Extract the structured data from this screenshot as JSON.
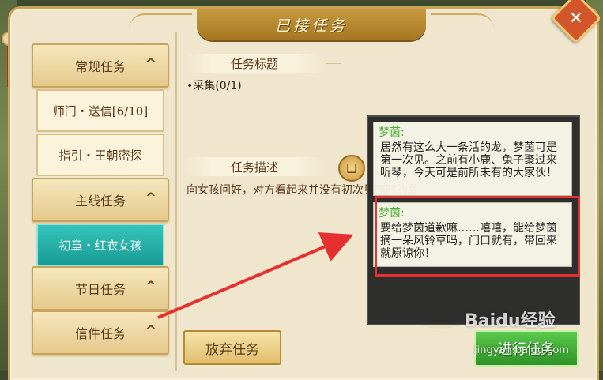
{
  "window": {
    "title": "已接任务",
    "close_label": "✕"
  },
  "categories": [
    {
      "label": "常规任务",
      "chevron": "^"
    },
    {
      "label": "主线任务",
      "chevron": "^"
    },
    {
      "label": "节日任务",
      "chevron": "^"
    },
    {
      "label": "信件任务",
      "chevron": "^"
    }
  ],
  "subtasks": [
    {
      "label": "师门・送信[6/10]"
    },
    {
      "label": "指引・王朝密探"
    },
    {
      "label": "初章・红衣女孩",
      "active": true
    }
  ],
  "task": {
    "title_head": "任务标题",
    "objective": "•采集(0/1)",
    "desc_head": "任务描述",
    "description": "向女孩问好，对方看起来并没有初次见面时的敌意"
  },
  "dialog": [
    {
      "speaker": "梦茵:",
      "text": "居然有这么大一条活的龙，梦茵可是第一次见。之前有小鹿、兔子聚过来听琴，今天可是前所未有的大家伙！"
    },
    {
      "speaker": "梦茵:",
      "text": "要给梦茵道歉嘛……嘻嘻，能给梦茵摘一朵风铃草吗，门口就有，带回来就原谅你！"
    }
  ],
  "buttons": {
    "abandon": "放弃任务",
    "go": "进行任务"
  },
  "watermark": {
    "brand": "Baidu经验",
    "url": "jingyan.baidu.com"
  },
  "icons": {
    "book": "book-icon",
    "close": "close-icon"
  }
}
